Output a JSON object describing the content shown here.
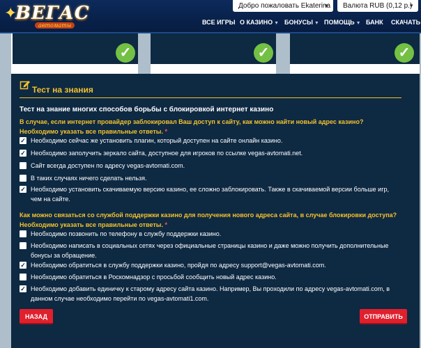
{
  "logo": {
    "main": "ВЕГАС",
    "sub": "автоматы"
  },
  "topbar": {
    "welcome": "Добро пожаловать Ekaterina",
    "currency": "Валюта RUB (0,12 р.)"
  },
  "nav": {
    "all_games": "ВСЕ ИГРЫ",
    "about": "О КАЗИНО",
    "bonuses": "БОНУСЫ",
    "help": "ПОМОЩЬ",
    "bank": "БАНК",
    "download": "СКАЧАТЬ"
  },
  "quiz": {
    "title": "Тест на знания",
    "subtitle": "Тест на знание многих способов борьбы с блокировкой интернет казино",
    "q1": {
      "text": "В случае, если интернет провайдер заблокировал Ваш доступ к сайту, как можно найти новый адрес казино? Необходимо указать все правильные ответы.",
      "required": "*",
      "options": [
        {
          "label": "Необходимо сейчас же установить плагин, который доступен на сайте онлайн казино.",
          "checked": true
        },
        {
          "label": "Необходимо заполучить зеркало сайта, доступное для игроков по ссылке vegas-avtomati.net.",
          "checked": true
        },
        {
          "label": "Сайт всегда доступен по адресу vegas-avtomati.com.",
          "checked": false
        },
        {
          "label": "В таких случаях ничего сделать нельзя.",
          "checked": false
        },
        {
          "label": "Необходимо установить скачиваемую версию казино, ее сложно заблокировать. Также в скачиваемой версии больше игр, чем на сайте.",
          "checked": true
        }
      ]
    },
    "q2": {
      "text": "Как можно связаться со службой поддержки казино для получения нового адреса сайта, в случае блокировки доступа? Необходимо указать все правильные ответы.",
      "required": "*",
      "options": [
        {
          "label": "Необходимо позвонить по телефону в службу поддержки казино.",
          "checked": false
        },
        {
          "label": "Необходимо написать в социальных сетях через официальные страницы казино и даже можно получить дополнительные бонусы за обращение.",
          "checked": false
        },
        {
          "label": "Необходимо обратиться в службу поддержки казино, пройдя по адресу support@vegas-avtomati.com.",
          "checked": true
        },
        {
          "label": "Необходимо обратиться в Роскомнадзор с просьбой сообщить новый адрес казино.",
          "checked": false
        },
        {
          "label": "Необходимо добавить единичку к старому адресу сайта казино. Например, Вы проходили по адресу vegas-avtomati.com, в данном случае необходимо перейти по vegas-avtomati1.com.",
          "checked": true
        }
      ]
    },
    "back_label": "НАЗАД",
    "submit_label": "ОТПРАВИТЬ"
  },
  "colors": {
    "accent": "#f2c12e",
    "panel": "#0e2942",
    "button": "#e0202d",
    "check": "#73c044"
  }
}
